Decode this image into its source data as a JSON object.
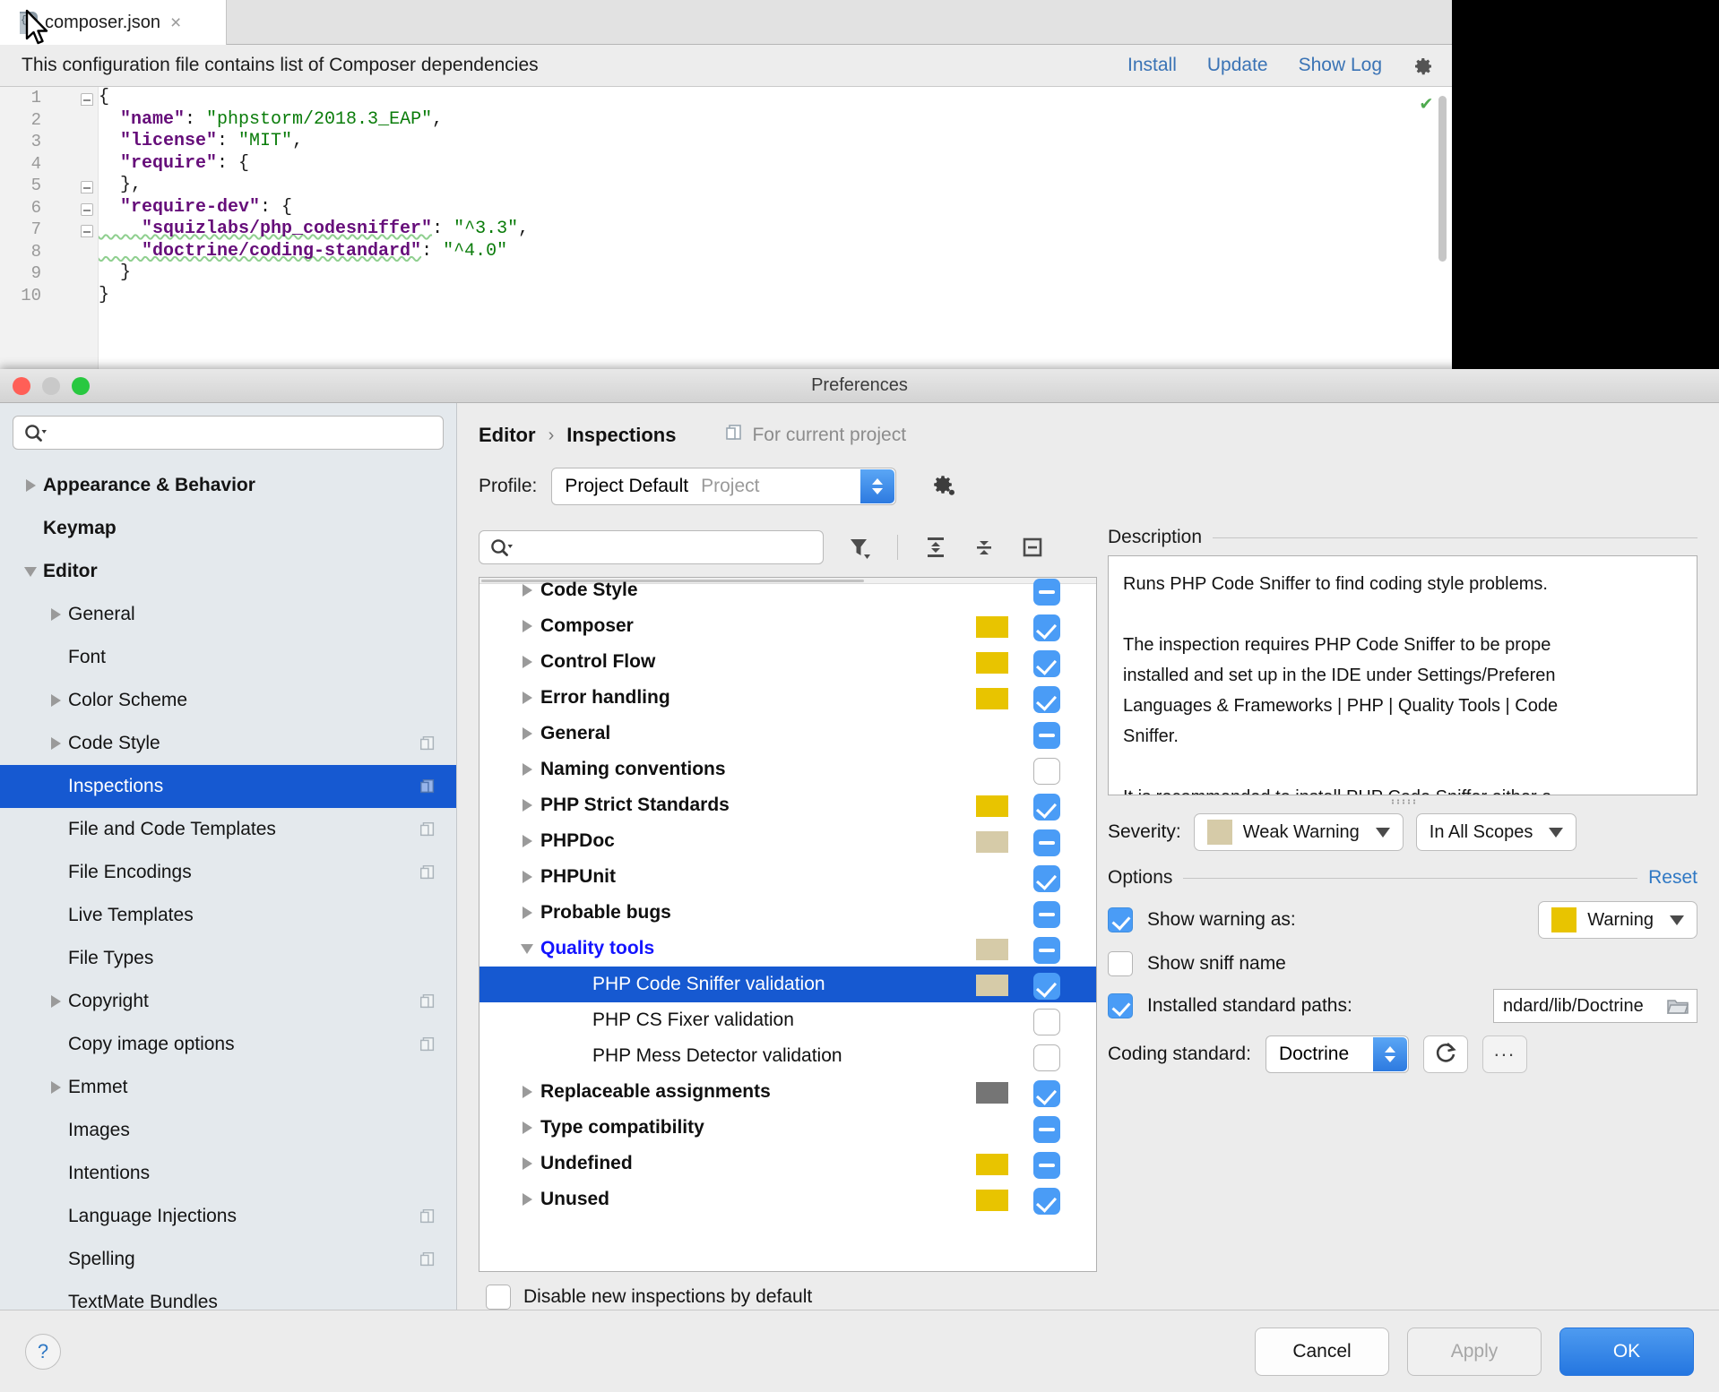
{
  "editor": {
    "tab": {
      "label": "composer.json",
      "close": "×",
      "icon": "json-file-icon"
    },
    "notification": {
      "text": "This configuration file contains list of Composer dependencies",
      "links": [
        "Install",
        "Update",
        "Show Log"
      ],
      "gear_icon": "gear-icon"
    },
    "line_numbers": [
      "1",
      "2",
      "3",
      "4",
      "5",
      "6",
      "7",
      "8",
      "9",
      "10"
    ],
    "code_lines": [
      [
        {
          "t": "{",
          "c": "p"
        }
      ],
      [
        {
          "t": "  \"name\"",
          "c": "k"
        },
        {
          "t": ": ",
          "c": "p"
        },
        {
          "t": "\"phpstorm/2018.3_EAP\"",
          "c": "s"
        },
        {
          "t": ",",
          "c": "p"
        }
      ],
      [
        {
          "t": "  \"license\"",
          "c": "k"
        },
        {
          "t": ": ",
          "c": "p"
        },
        {
          "t": "\"MIT\"",
          "c": "s"
        },
        {
          "t": ",",
          "c": "p"
        }
      ],
      [
        {
          "t": "  \"require\"",
          "c": "k"
        },
        {
          "t": ": {",
          "c": "p"
        }
      ],
      [
        {
          "t": "  },",
          "c": "p"
        }
      ],
      [
        {
          "t": "  \"require-dev\"",
          "c": "k"
        },
        {
          "t": ": {",
          "c": "p"
        }
      ],
      [
        {
          "t": "    \"squizlabs/php_codesniffer\"",
          "c": "k sq"
        },
        {
          "t": ": ",
          "c": "p"
        },
        {
          "t": "\"^3.3\"",
          "c": "s"
        },
        {
          "t": ",",
          "c": "p"
        }
      ],
      [
        {
          "t": "    \"doctrine/coding-standard\"",
          "c": "k sq"
        },
        {
          "t": ": ",
          "c": "p"
        },
        {
          "t": "\"^4.0\"",
          "c": "s"
        }
      ],
      [
        {
          "t": "  }",
          "c": "p"
        }
      ],
      [
        {
          "t": "}",
          "c": "p"
        }
      ]
    ],
    "status_ok": "✔"
  },
  "dialog": {
    "title": "Preferences",
    "sidebar": {
      "search_placeholder": "",
      "search_value": "",
      "items": [
        {
          "label": "Appearance & Behavior",
          "level": 1,
          "twisty": "right",
          "bold": true,
          "copy": false,
          "selected": false
        },
        {
          "label": "Keymap",
          "level": 1,
          "twisty": "none",
          "bold": true,
          "copy": false,
          "selected": false
        },
        {
          "label": "Editor",
          "level": 1,
          "twisty": "down",
          "bold": true,
          "copy": false,
          "selected": false
        },
        {
          "label": "General",
          "level": 2,
          "twisty": "right",
          "bold": false,
          "copy": false,
          "selected": false
        },
        {
          "label": "Font",
          "level": 2,
          "twisty": "none",
          "bold": false,
          "copy": false,
          "selected": false
        },
        {
          "label": "Color Scheme",
          "level": 2,
          "twisty": "right",
          "bold": false,
          "copy": false,
          "selected": false
        },
        {
          "label": "Code Style",
          "level": 2,
          "twisty": "right",
          "bold": false,
          "copy": true,
          "selected": false
        },
        {
          "label": "Inspections",
          "level": 2,
          "twisty": "none",
          "bold": false,
          "copy": true,
          "selected": true
        },
        {
          "label": "File and Code Templates",
          "level": 2,
          "twisty": "none",
          "bold": false,
          "copy": true,
          "selected": false
        },
        {
          "label": "File Encodings",
          "level": 2,
          "twisty": "none",
          "bold": false,
          "copy": true,
          "selected": false
        },
        {
          "label": "Live Templates",
          "level": 2,
          "twisty": "none",
          "bold": false,
          "copy": false,
          "selected": false
        },
        {
          "label": "File Types",
          "level": 2,
          "twisty": "none",
          "bold": false,
          "copy": false,
          "selected": false
        },
        {
          "label": "Copyright",
          "level": 2,
          "twisty": "right",
          "bold": false,
          "copy": true,
          "selected": false
        },
        {
          "label": "Copy image options",
          "level": 2,
          "twisty": "none",
          "bold": false,
          "copy": true,
          "selected": false
        },
        {
          "label": "Emmet",
          "level": 2,
          "twisty": "right",
          "bold": false,
          "copy": false,
          "selected": false
        },
        {
          "label": "Images",
          "level": 2,
          "twisty": "none",
          "bold": false,
          "copy": false,
          "selected": false
        },
        {
          "label": "Intentions",
          "level": 2,
          "twisty": "none",
          "bold": false,
          "copy": false,
          "selected": false
        },
        {
          "label": "Language Injections",
          "level": 2,
          "twisty": "none",
          "bold": false,
          "copy": true,
          "selected": false
        },
        {
          "label": "Spelling",
          "level": 2,
          "twisty": "none",
          "bold": false,
          "copy": true,
          "selected": false
        },
        {
          "label": "TextMate Bundles",
          "level": 2,
          "twisty": "none",
          "bold": false,
          "copy": false,
          "selected": false
        }
      ]
    },
    "breadcrumb": {
      "root": "Editor",
      "separator": "›",
      "current": "Inspections",
      "scope": "For current project",
      "scope_icon": "copy-icon"
    },
    "profile": {
      "label": "Profile:",
      "value": "Project Default",
      "suffix": "Project",
      "gear_icon": "gear-icon"
    },
    "filter_bar": {
      "search_placeholder": "",
      "search_value": "",
      "icons": [
        "filter-icon",
        "expand-all-icon",
        "collapse-all-icon",
        "show-only-enabled-icon"
      ]
    },
    "inspections": [
      {
        "label": "Code Style",
        "level": 1,
        "twisty": "right",
        "swatch": null,
        "check": "mixed",
        "selected": false,
        "clipped": true
      },
      {
        "label": "Composer",
        "level": 1,
        "twisty": "right",
        "swatch": "#e8c400",
        "check": "on",
        "selected": false
      },
      {
        "label": "Control Flow",
        "level": 1,
        "twisty": "right",
        "swatch": "#e8c400",
        "check": "on",
        "selected": false
      },
      {
        "label": "Error handling",
        "level": 1,
        "twisty": "right",
        "swatch": "#e8c400",
        "check": "on",
        "selected": false
      },
      {
        "label": "General",
        "level": 1,
        "twisty": "right",
        "swatch": null,
        "check": "mixed",
        "selected": false
      },
      {
        "label": "Naming conventions",
        "level": 1,
        "twisty": "right",
        "swatch": null,
        "check": "off",
        "selected": false
      },
      {
        "label": "PHP Strict Standards",
        "level": 1,
        "twisty": "right",
        "swatch": "#e8c400",
        "check": "on",
        "selected": false
      },
      {
        "label": "PHPDoc",
        "level": 1,
        "twisty": "right",
        "swatch": "#d6cba8",
        "check": "mixed",
        "selected": false
      },
      {
        "label": "PHPUnit",
        "level": 1,
        "twisty": "right",
        "swatch": null,
        "check": "on",
        "selected": false
      },
      {
        "label": "Probable bugs",
        "level": 1,
        "twisty": "right",
        "swatch": null,
        "check": "mixed",
        "selected": false
      },
      {
        "label": "Quality tools",
        "level": 1,
        "twisty": "down",
        "swatch": "#d6cba8",
        "check": "mixed",
        "selected": false,
        "open": true
      },
      {
        "label": "PHP Code Sniffer validation",
        "level": 2,
        "twisty": "none",
        "swatch": "#d6cba8",
        "check": "on",
        "selected": true
      },
      {
        "label": "PHP CS Fixer validation",
        "level": 2,
        "twisty": "none",
        "swatch": null,
        "check": "off",
        "selected": false
      },
      {
        "label": "PHP Mess Detector validation",
        "level": 2,
        "twisty": "none",
        "swatch": null,
        "check": "off",
        "selected": false
      },
      {
        "label": "Replaceable assignments",
        "level": 1,
        "twisty": "right",
        "swatch": "#757575",
        "check": "on",
        "selected": false
      },
      {
        "label": "Type compatibility",
        "level": 1,
        "twisty": "right",
        "swatch": null,
        "check": "mixed",
        "selected": false
      },
      {
        "label": "Undefined",
        "level": 1,
        "twisty": "right",
        "swatch": "#e8c400",
        "check": "mixed",
        "selected": false
      },
      {
        "label": "Unused",
        "level": 1,
        "twisty": "right",
        "swatch": "#e8c400",
        "check": "on",
        "selected": false
      }
    ],
    "disable_new": {
      "label": "Disable new inspections by default",
      "checked": false
    },
    "description": {
      "title": "Description",
      "text": "Runs PHP Code Sniffer to find coding style problems.\n\nThe inspection requires PHP Code Sniffer to be prope\ninstalled and set up in the IDE under Settings/Preferen\nLanguages & Frameworks | PHP | Quality Tools | Code\nSniffer.\n\nIt is recommended to install PHP Code Sniffer either a\nComposer dependency or globally. For more informati"
    },
    "severity": {
      "label": "Severity:",
      "value": "Weak Warning",
      "color": "#d6cba8",
      "scope": "In All Scopes"
    },
    "options": {
      "title": "Options",
      "reset": "Reset",
      "show_warning_as": {
        "label": "Show warning as:",
        "checked": true,
        "value": "Warning",
        "color": "#e8c400"
      },
      "show_sniff_name": {
        "label": "Show sniff name",
        "checked": false
      },
      "installed_standard_paths": {
        "label": "Installed standard paths:",
        "checked": true,
        "value": "ndard/lib/Doctrine",
        "icon": "folder-icon"
      },
      "coding_standard": {
        "label": "Coding standard:",
        "value": "Doctrine",
        "refresh_icon": "refresh-icon",
        "more_label": "..."
      }
    },
    "footer": {
      "help": "?",
      "cancel": "Cancel",
      "apply": "Apply",
      "ok": "OK"
    }
  }
}
